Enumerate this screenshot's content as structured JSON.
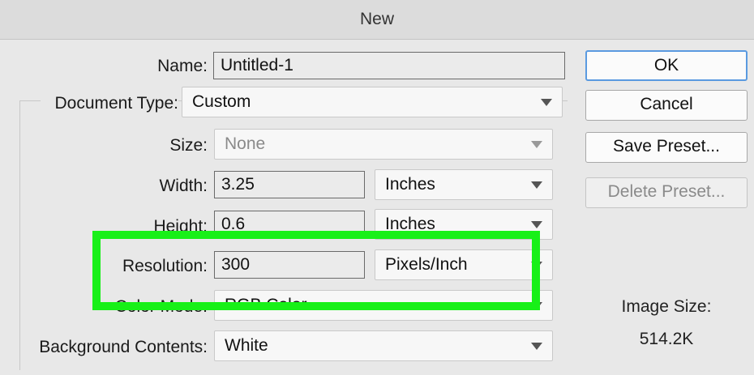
{
  "window": {
    "title": "New"
  },
  "form": {
    "name": {
      "label": "Name:",
      "value": "Untitled-1"
    },
    "document_type": {
      "label": "Document Type:",
      "value": "Custom"
    },
    "size": {
      "label": "Size:",
      "value": "None"
    },
    "width": {
      "label": "Width:",
      "value": "3.25",
      "unit": "Inches"
    },
    "height": {
      "label": "Height:",
      "value": "0.6",
      "unit": "Inches"
    },
    "resolution": {
      "label": "Resolution:",
      "value": "300",
      "unit": "Pixels/Inch"
    },
    "color_mode": {
      "label": "Color Mode:",
      "value": "RGB Color"
    },
    "background": {
      "label": "Background Contents:",
      "value": "White"
    }
  },
  "buttons": {
    "ok": "OK",
    "cancel": "Cancel",
    "save_preset": "Save Preset...",
    "delete_preset": "Delete Preset..."
  },
  "image_size": {
    "label": "Image Size:",
    "value": "514.2K"
  },
  "highlight_color": "#18f018"
}
